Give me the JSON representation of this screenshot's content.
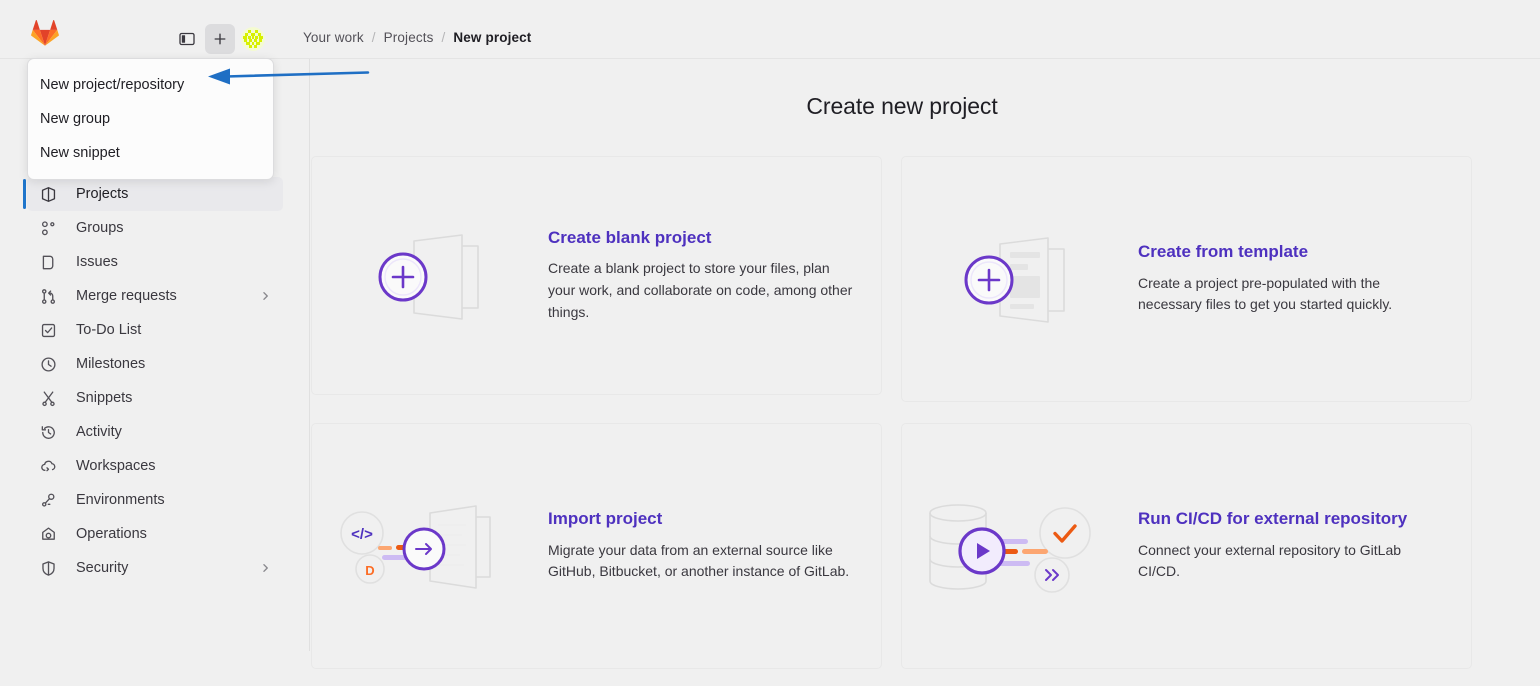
{
  "header": {
    "logo_name": "gitlab-logo",
    "toggle_sidebar_label": "Toggle sidebar",
    "new_menu_label": "+",
    "avatar_label": "User avatar"
  },
  "breadcrumb": {
    "items": [
      {
        "label": "Your work",
        "current": false
      },
      {
        "label": "Projects",
        "current": false
      },
      {
        "label": "New project",
        "current": true
      }
    ],
    "separator": "/"
  },
  "dropdown": {
    "items": [
      {
        "label": "New project/repository"
      },
      {
        "label": "New group"
      },
      {
        "label": "New snippet"
      }
    ]
  },
  "sidebar": {
    "items": [
      {
        "label": "Projects",
        "icon": "project-icon",
        "active": true,
        "chevron": false
      },
      {
        "label": "Groups",
        "icon": "group-icon",
        "active": false,
        "chevron": false
      },
      {
        "label": "Issues",
        "icon": "issues-icon",
        "active": false,
        "chevron": false
      },
      {
        "label": "Merge requests",
        "icon": "merge-request-icon",
        "active": false,
        "chevron": true
      },
      {
        "label": "To-Do List",
        "icon": "todo-check-icon",
        "active": false,
        "chevron": false
      },
      {
        "label": "Milestones",
        "icon": "clock-icon",
        "active": false,
        "chevron": false
      },
      {
        "label": "Snippets",
        "icon": "snippet-scissors-icon",
        "active": false,
        "chevron": false
      },
      {
        "label": "Activity",
        "icon": "history-icon",
        "active": false,
        "chevron": false
      },
      {
        "label": "Workspaces",
        "icon": "cloud-workspace-icon",
        "active": false,
        "chevron": false
      },
      {
        "label": "Environments",
        "icon": "environment-icon",
        "active": false,
        "chevron": false
      },
      {
        "label": "Operations",
        "icon": "operations-icon",
        "active": false,
        "chevron": false
      },
      {
        "label": "Security",
        "icon": "shield-icon",
        "active": false,
        "chevron": true
      }
    ]
  },
  "main": {
    "title": "Create new project",
    "cards": [
      {
        "title": "Create blank project",
        "description": "Create a blank project to store your files, plan your work, and collaborate on code, among other things.",
        "illustration": "blank-project-illustration"
      },
      {
        "title": "Create from template",
        "description": "Create a project pre-populated with the necessary files to get you started quickly.",
        "illustration": "template-project-illustration"
      },
      {
        "title": "Import project",
        "description": "Migrate your data from an external source like GitHub, Bitbucket, or another instance of GitLab.",
        "illustration": "import-project-illustration"
      },
      {
        "title": "Run CI/CD for external repository",
        "description": "Connect your external repository to GitLab CI/CD.",
        "illustration": "cicd-external-repo-illustration"
      }
    ]
  },
  "annotation": {
    "arrow_name": "blue-annotation-arrow",
    "arrow_color": "#1f6fc4",
    "points_to": "New project/repository"
  },
  "colors": {
    "accent_purple": "#4e31bf",
    "active_indicator_blue": "#1f75cb",
    "background": "#f0f0f0",
    "orange": "#fc6d26",
    "avatar_green": "#d7f000"
  }
}
